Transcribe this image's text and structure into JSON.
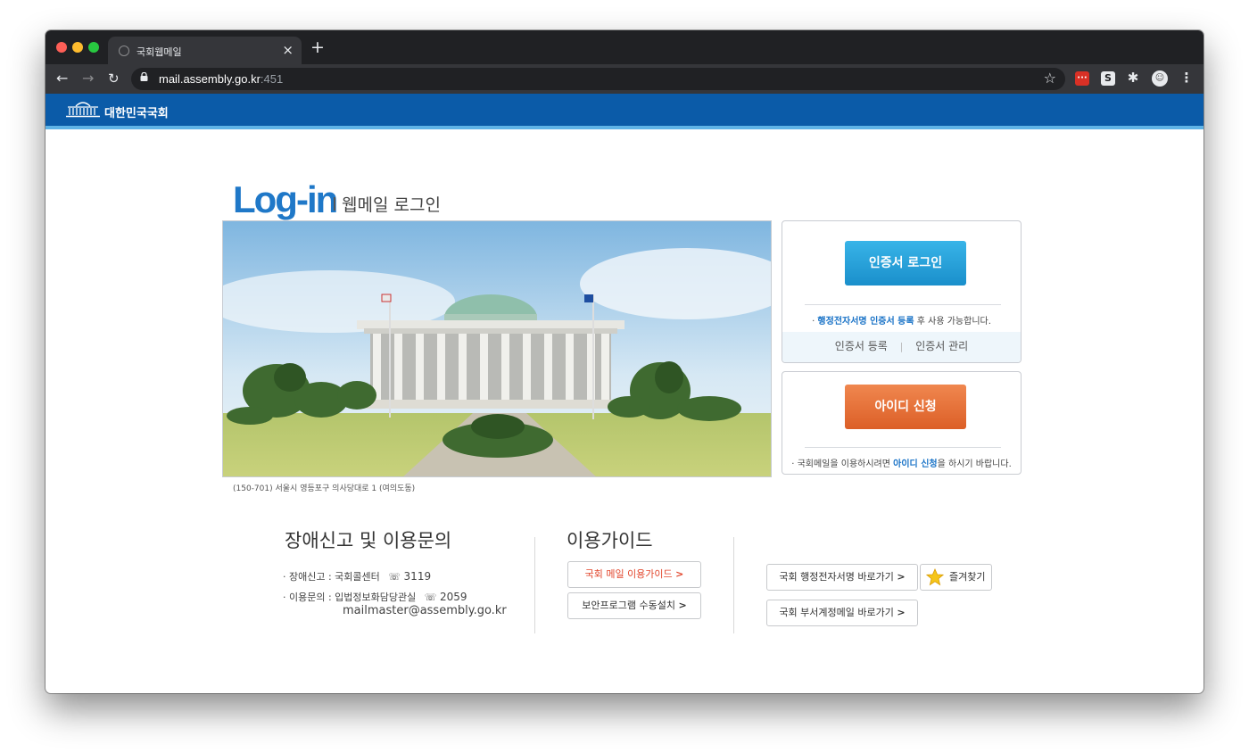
{
  "browser": {
    "tab_title": "국회웹메일",
    "tab_close": "×",
    "new_tab": "+",
    "url_host": "mail.assembly.go.kr",
    "url_port": ":451",
    "icons": [
      "back-arrow-icon",
      "forward-arrow-icon",
      "reload-icon",
      "lock-icon",
      "bookmark-star-icon",
      "extension-puzzle-icon",
      "profile-avatar-icon",
      "more-menu-icon"
    ]
  },
  "site": {
    "name": "대한민국국회"
  },
  "login": {
    "heading": "Log-in",
    "subheading": "웹메일 로그인"
  },
  "address": "(150-701) 서울시 영등포구 의사당대로 1 (여의도동)",
  "cert_panel": {
    "button": "인증서 로그인",
    "note_prefix": "· ",
    "note_highlight": "행정전자서명 인증서 등록",
    "note_suffix": " 후 사용 가능합니다.",
    "link_register": "인증서 등록",
    "link_divider": "|",
    "link_manage": "인증서 관리"
  },
  "id_panel": {
    "button": "아이디 신청",
    "note_prefix": "· 국회메일을 이용하시려면 ",
    "note_highlight": "아이디 신청",
    "note_suffix": "을 하시기 바랍니다."
  },
  "support": {
    "title": "장애신고 및 이용문의",
    "report_label": "· 장애신고 : 국회콜센터",
    "report_number": "3119",
    "inquiry_label": "· 이용문의 : 입법정보화담당관실",
    "inquiry_number": "2059",
    "email": "mailmaster@assembly.go.kr"
  },
  "guide": {
    "title": "이용가이드",
    "mail_guide": "국회 메일 이용가이드",
    "security_install": "보안프로그램 수동설치",
    "esign_link": "국회 행정전자서명 바로가기",
    "dept_mail_link": "국회 부서계정메일 바로가기",
    "favorites": "즐겨찾기",
    "arrow": ">"
  },
  "colors": {
    "header_blue": "#0b5ba8",
    "cert_button": "#1f9bd6",
    "id_button": "#e2662e",
    "highlight": "#1a73c7"
  }
}
